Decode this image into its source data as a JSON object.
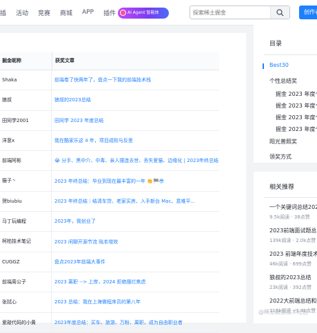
{
  "nav": {
    "items": [
      "插",
      "活动",
      "竞赛",
      "商城",
      "APP",
      "插件"
    ],
    "ai_badge": "AI Agent 智能体"
  },
  "search": {
    "placeholder": "探索稀土掘金"
  },
  "create_button": "创作者中",
  "table": {
    "headers": [
      "掘金昵称",
      "获奖文章"
    ],
    "rows": [
      {
        "name": "Shaka",
        "article": "前端卷了快两年了，盘点一下我的前端技术栈"
      },
      {
        "name": "狼叔",
        "article": "狼叔的2023总结"
      },
      {
        "name": "田同学2001",
        "article": "田同学 2023 年度总结"
      },
      {
        "name": "洋葱x",
        "article": "我在酷家乐这 4 年，项目成败与反思"
      },
      {
        "name": "前端阿彬",
        "article": "😭 分手、黑中介、中毒、亲人撞连去世、丢失爱猫、边缘化 | 2023年终总结"
      },
      {
        "name": "猫子丶",
        "article": "2023 年终总结：毕业到现在最丰富的一年 👏🏁😎"
      },
      {
        "name": "贺biubiu",
        "article": "2023 年终总结｜结清车贷、老家买房、入手新台 Mac、意难平..."
      },
      {
        "name": "马丁玩编程",
        "article": "2023年，我创业了"
      },
      {
        "name": "柯柏技术笔记",
        "article": "2023 闲聊开源节流 陆本增效"
      },
      {
        "name": "CUGGZ",
        "article": "盘点2023年前端大事件"
      },
      {
        "name": "前端周公子",
        "article": "2023 离职 --> 上岸，2024 拒绝摆烂焦虑"
      },
      {
        "name": "张拭心",
        "article": "2023 总结：我在上海做程序员的第八年"
      },
      {
        "name": "爱敲代码的小黄",
        "article": "2023年度总结：买车、旅游、万粉、离职，成为自由职业者"
      }
    ]
  },
  "toc": {
    "title": "目录",
    "items": [
      {
        "label": "Best30",
        "level": 1,
        "active": true
      },
      {
        "label": "个性总结奖",
        "level": 1,
        "active": false
      },
      {
        "label": "掘金 2023 年度个",
        "level": 2,
        "active": false
      },
      {
        "label": "掘金 2023 年度个",
        "level": 2,
        "active": false
      },
      {
        "label": "掘金 2023 年度个",
        "level": 2,
        "active": false
      },
      {
        "label": "掘金 2023 年度个",
        "level": 2,
        "active": false
      },
      {
        "label": "阳光普照奖",
        "level": 1,
        "active": false
      },
      {
        "label": "领奖方式",
        "level": 1,
        "active": false
      }
    ]
  },
  "related": {
    "title": "相关推荐",
    "items": [
      {
        "title": "一个关键词总结202",
        "meta": "9.5k阅读 · 38点赞"
      },
      {
        "title": "2023前端面试题总",
        "meta": "139k阅读 · 2.0k点赞"
      },
      {
        "title": "2023 前端年度技术",
        "meta": "46k阅读 · 699点赞"
      },
      {
        "title": "狼叔的2023总结",
        "meta": "23k阅读 · 392点赞"
      },
      {
        "title": "2022大前端总结和",
        "meta": "116k阅读 · 1.4k点赞"
      }
    ]
  },
  "watermark": "@稀土掘金技术社区"
}
